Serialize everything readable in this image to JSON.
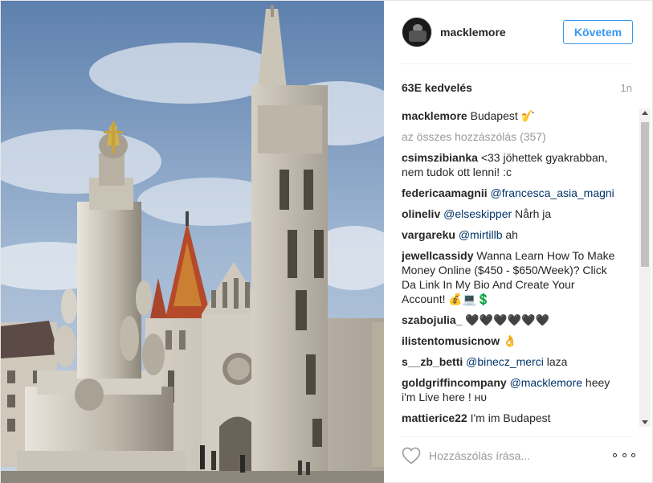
{
  "post": {
    "username": "macklemore",
    "follow_label": "Követem",
    "likes": "63E kedvelés",
    "time": "1n",
    "caption_user": "macklemore",
    "caption_text": "Budapest 🎷",
    "all_comments": "az összes hozzászólás (357)"
  },
  "comments": [
    {
      "user": "csimszibianka",
      "text": "<33 jöhettek gyakrabban, nem tudok ott lenni! :c"
    },
    {
      "user": "federicaamagnii",
      "mention": "@francesca_asia_magni",
      "text": ""
    },
    {
      "user": "olineliv",
      "mention": "@elseskipper",
      "text": " Nårh ja"
    },
    {
      "user": "vargareku",
      "mention": "@mirtillb",
      "text": " ah"
    },
    {
      "user": "jewellcassidy",
      "text": "Wanna Learn How To Make Money Online ($450 - $650/Week)? Click Da Link In My Bio And Create Your Account! 💰💻💲"
    },
    {
      "user": "szabojulia_",
      "text": "🖤🖤🖤🖤🖤🖤"
    },
    {
      "user": "ilistentomusicnow",
      "text": "👌"
    },
    {
      "user": "s__zb_betti",
      "mention": "@binecz_merci",
      "text": " laza"
    },
    {
      "user": "goldgriffincompany",
      "mention": "@macklemore",
      "text": " heey i'm Live here ! ʜᴜ"
    },
    {
      "user": "mattierice22",
      "text": "I'm im Budapest"
    }
  ],
  "footer": {
    "comment_placeholder": "Hozzászólás írása..."
  },
  "icons": {
    "like": "heart-icon",
    "more": "more-options-icon",
    "avatar": "avatar"
  },
  "colors": {
    "accent": "#3897f0",
    "mention": "#003569",
    "muted": "#999999"
  }
}
